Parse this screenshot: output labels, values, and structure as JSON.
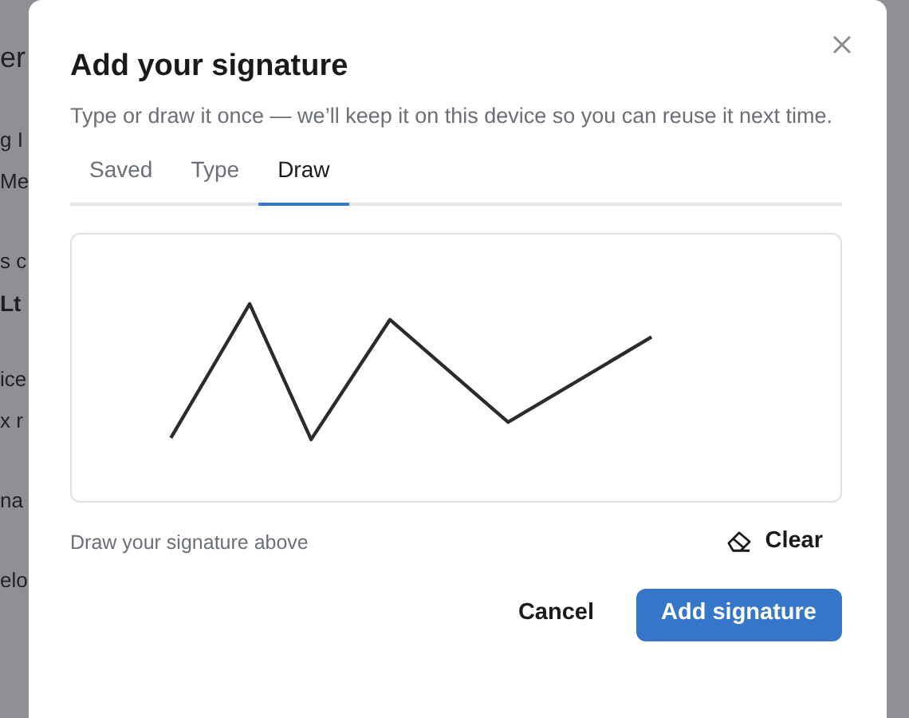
{
  "background": {
    "fragments": [
      {
        "text": "er",
        "kind": "heading"
      },
      {
        "text": "g I",
        "kind": "text"
      },
      {
        "text": "Me",
        "kind": "text"
      },
      {
        "text": "s c",
        "kind": "text"
      },
      {
        "text": "Lt",
        "kind": "strong"
      },
      {
        "text": "ice",
        "kind": "text"
      },
      {
        "text": "x r",
        "kind": "text"
      },
      {
        "text": "na",
        "kind": "text"
      },
      {
        "text": "elo",
        "kind": "text"
      }
    ]
  },
  "dialog": {
    "title": "Add your signature",
    "subtitle": "Type or draw it once — we’ll keep it on this device so you can reuse it next time.",
    "tabs": [
      {
        "label": "Saved",
        "selected": false
      },
      {
        "label": "Type",
        "selected": false
      },
      {
        "label": "Draw",
        "selected": true
      }
    ],
    "hint": "Draw your signature above",
    "clear": "Clear",
    "buttons": [
      {
        "label": "Cancel",
        "kind": "secondary"
      },
      {
        "label": "Add signature",
        "kind": "primary"
      }
    ]
  }
}
